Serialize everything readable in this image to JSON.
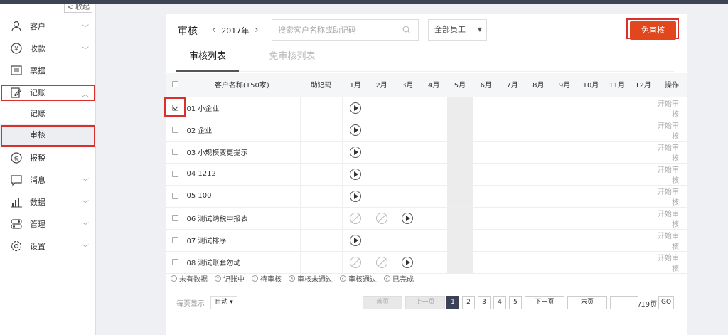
{
  "sidebar": {
    "collapse_label": "收起",
    "items": [
      {
        "label": "客户"
      },
      {
        "label": "收款"
      },
      {
        "label": "票据"
      },
      {
        "label": "记账"
      },
      {
        "label": "报税"
      },
      {
        "label": "消息"
      },
      {
        "label": "数据"
      },
      {
        "label": "管理"
      },
      {
        "label": "设置"
      }
    ],
    "sub_items": [
      {
        "label": "记账"
      },
      {
        "label": "审核"
      }
    ]
  },
  "header": {
    "title": "审核",
    "year": "2017年",
    "search_placeholder": "搜索客户名称或助记码",
    "staff_select": "全部员工",
    "exempt_button": "免审核"
  },
  "tabs": [
    {
      "label": "审核列表"
    },
    {
      "label": "免审核列表"
    }
  ],
  "table": {
    "col_name": "客户名称(150家)",
    "col_memo": "助记码",
    "months": [
      "1月",
      "2月",
      "3月",
      "4月",
      "5月",
      "6月",
      "7月",
      "8月",
      "9月",
      "10月",
      "11月",
      "12月"
    ],
    "col_op": "操作",
    "rows": [
      {
        "name": "01 小企业",
        "checked": true,
        "m1": "play",
        "m2": "",
        "m3": "",
        "op": "开始审核"
      },
      {
        "name": "02 企业",
        "checked": false,
        "m1": "play",
        "m2": "",
        "m3": "",
        "op": "开始审核"
      },
      {
        "name": "03 小规模变更提示",
        "checked": false,
        "m1": "play",
        "m2": "",
        "m3": "",
        "op": "开始审核"
      },
      {
        "name": "04 1212",
        "checked": false,
        "m1": "play",
        "m2": "",
        "m3": "",
        "op": "开始审核"
      },
      {
        "name": "05 100",
        "checked": false,
        "m1": "play",
        "m2": "",
        "m3": "",
        "op": "开始审核"
      },
      {
        "name": "06 测试纳税申报表",
        "checked": false,
        "m1": "nodata",
        "m2": "nodata",
        "m3": "play",
        "op": "开始审核"
      },
      {
        "name": "07 测试排序",
        "checked": false,
        "m1": "play",
        "m2": "",
        "m3": "",
        "op": "开始审核"
      },
      {
        "name": "08 测试账套勿动",
        "checked": false,
        "m1": "nodata",
        "m2": "nodata",
        "m3": "play",
        "op": "开始审核"
      }
    ]
  },
  "legend": [
    {
      "label": "未有数据"
    },
    {
      "label": "记账中"
    },
    {
      "label": "待审核"
    },
    {
      "label": "审核未通过"
    },
    {
      "label": "审核通过"
    },
    {
      "label": "已完成"
    }
  ],
  "pager": {
    "per_page_label": "每页显示",
    "per_page_value": "自动",
    "first": "首页",
    "prev": "上一页",
    "pages": [
      "1",
      "2",
      "3",
      "4",
      "5"
    ],
    "next": "下一页",
    "last": "末页",
    "total": "/19页",
    "go": "GO"
  }
}
